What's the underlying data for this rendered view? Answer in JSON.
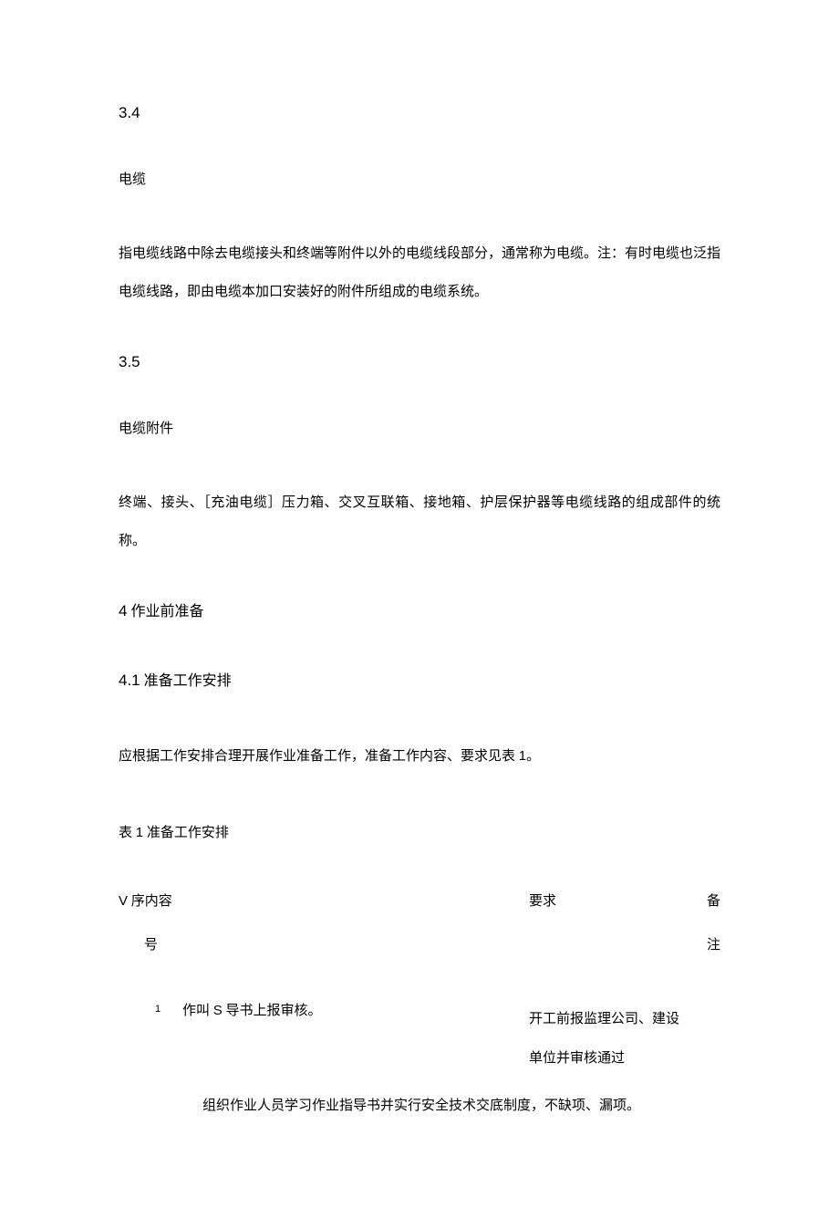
{
  "section_3_4": {
    "num": "3.4",
    "title": "电缆",
    "para": "指电缆线路中除去电缆接头和终端等附件以外的电缆线段部分，通常称为电缆。注：有时电缆也泛指电缆线路，即由电缆本加口安装好的附件所组成的电缆系统。"
  },
  "section_3_5": {
    "num": "3.5",
    "title": "电缆附件",
    "para": "终端、接头、［充油电缆］压力箱、交叉互联箱、接地箱、护层保护器等电缆线路的组成部件的统称。"
  },
  "section_4": {
    "heading_num": "4",
    "heading_text": " 作业前准备"
  },
  "section_4_1": {
    "heading_num": "4.1",
    "heading_text": " 准备工作安排",
    "para_prefix": "应根据工作安排合理开展作业准备工作，准备工作内容、要求见表 ",
    "para_num": "1",
    "para_suffix": "。",
    "table_caption_a": "表 ",
    "table_caption_num": "1",
    "table_caption_b": " 准备工作安排"
  },
  "table": {
    "header": {
      "col1_v": "V",
      "col1_text": " 序内容",
      "col2": "要求",
      "col3": "备",
      "row2_a": "号",
      "row2_b": "注"
    },
    "row1": {
      "num": "1",
      "content_a": "作叫 ",
      "content_s": "S",
      "content_b": " 导书上报审核。",
      "req": "开工前报监理公司、建设单位并审核通过"
    },
    "bottom": "组织作业人员学习作业指导书并实行安全技术交底制度，不缺项、漏项。"
  }
}
